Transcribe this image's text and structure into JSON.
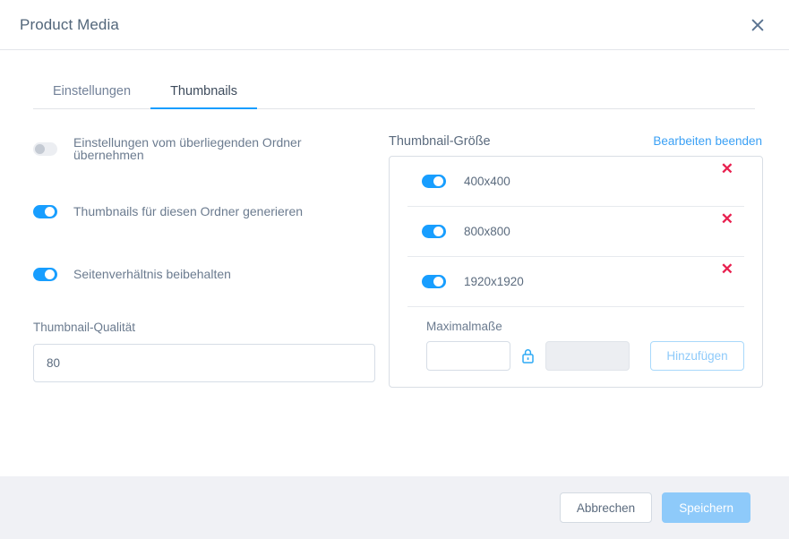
{
  "header": {
    "title": "Product Media",
    "close_icon": "close-icon"
  },
  "tabs": [
    {
      "label": "Einstellungen",
      "active": false
    },
    {
      "label": "Thumbnails",
      "active": true
    }
  ],
  "left_panel": {
    "toggles": [
      {
        "label": "Einstellungen vom überliegenden Ordner übernehmen",
        "on": false,
        "disabled": true
      },
      {
        "label": "Thumbnails für diesen Ordner generieren",
        "on": true,
        "disabled": false
      },
      {
        "label": "Seitenverhältnis beibehalten",
        "on": true,
        "disabled": false
      }
    ],
    "quality": {
      "label": "Thumbnail-Qualität",
      "value": "80",
      "placeholder": ""
    }
  },
  "right_panel": {
    "title": "Thumbnail-Größe",
    "edit_link": "Bearbeiten beenden",
    "sizes": [
      {
        "label": "400x400",
        "on": true,
        "remove_icon": "close-icon"
      },
      {
        "label": "800x800",
        "on": true,
        "remove_icon": "close-icon"
      },
      {
        "label": "1920x1920",
        "on": true,
        "remove_icon": "close-icon"
      }
    ],
    "max_dims": {
      "label": "Maximalmaße",
      "width_value": "",
      "width_placeholder": "",
      "lock_icon": "lock-closed-icon",
      "height_value": "",
      "height_placeholder": "",
      "add_button": "Hinzufügen"
    }
  },
  "footer": {
    "cancel_label": "Abbrechen",
    "save_label": "Speichern"
  },
  "colors": {
    "accent": "#189eff",
    "link": "#3aa0f5",
    "danger": "#e8204f",
    "footer_bg": "#f0f1f5",
    "disabled_blue": "#8ecafa"
  }
}
